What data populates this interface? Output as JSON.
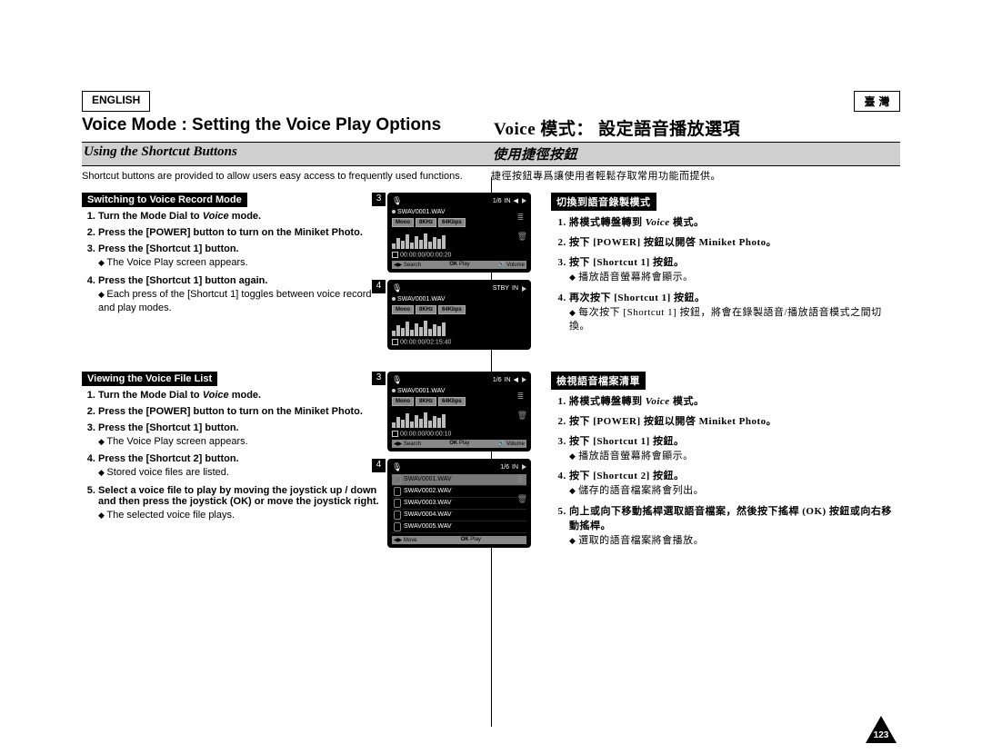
{
  "lang": {
    "en": "ENGLISH",
    "zh": "臺  灣"
  },
  "title": {
    "en": "Voice Mode : Setting the Voice Play Options",
    "zh": "Voice 模式： 設定語音播放選項"
  },
  "subtitle": {
    "en": "Using the Shortcut Buttons",
    "zh": "使用捷徑按鈕"
  },
  "intro": {
    "en": "Shortcut buttons are provided to allow users easy access to frequently used functions.",
    "zh": "捷徑按鈕專爲讓使用者輕鬆存取常用功能而提供。"
  },
  "sectionA": {
    "bar_en": "Switching to Voice Record Mode",
    "bar_zh": "切換到語音錄製模式",
    "en": {
      "s1a": "Turn the Mode Dial to ",
      "s1b": "Voice",
      "s1c": " mode.",
      "s2": "Press the [POWER] button to turn on the Miniket Photo.",
      "s3": "Press the [Shortcut 1] button.",
      "s3sub": "The Voice Play screen appears.",
      "s4": "Press the [Shortcut 1] button again.",
      "s4sub": "Each press of the [Shortcut 1] toggles between voice record and play modes."
    },
    "zh": {
      "s1a": "將模式轉盤轉到 ",
      "s1b": "Voice",
      "s1c": " 模式。",
      "s2": "按下 [POWER] 按鈕以開啓 Miniket Photo。",
      "s3": "按下 [Shortcut 1] 按鈕。",
      "s3sub": "播放語音螢幕將會顯示。",
      "s4": "再次按下 [Shortcut 1] 按鈕。",
      "s4sub": "每次按下 [Shortcut 1] 按鈕，將會在錄製語音/播放語音模式之間切換。"
    }
  },
  "sectionB": {
    "bar_en": "Viewing the Voice File List",
    "bar_zh": "檢視語音檔案清單",
    "en": {
      "s1a": "Turn the Mode Dial to ",
      "s1b": "Voice",
      "s1c": " mode.",
      "s2": "Press the [POWER] button to turn on the Miniket Photo.",
      "s3": "Press the [Shortcut 1] button.",
      "s3sub": "The Voice Play screen appears.",
      "s4": "Press the [Shortcut 2] button.",
      "s4sub": "Stored voice files are listed.",
      "s5": "Select a voice file to play by moving the joystick up / down and then press the joystick (OK) or move the joystick right.",
      "s5sub": "The selected voice file plays."
    },
    "zh": {
      "s1a": "將模式轉盤轉到 ",
      "s1b": "Voice",
      "s1c": " 模式。",
      "s2": "按下 [POWER] 按鈕以開啓 Miniket Photo。",
      "s3": "按下 [Shortcut 1] 按鈕。",
      "s3sub": "播放語音螢幕將會顯示。",
      "s4": "按下 [Shortcut 2] 按鈕。",
      "s4sub": "儲存的語音檔案將會列出。",
      "s5": "向上或向下移動搖桿選取語音檔案，然後按下搖桿 (OK) 按鈕或向右移動搖桿。",
      "s5sub": "選取的語音檔案將會播放。"
    }
  },
  "device": {
    "counter16": "1/6",
    "in": "IN",
    "file": "SWAV0001.WAV",
    "mono": "Mono",
    "khz": "8KHz",
    "kbps": "64Kbps",
    "time_a1": "00:00:00/00:00:20",
    "time_a2": "00:00:00/02:15:40",
    "time_b1": "00:00:00/00:00:10",
    "bottom_search": "Search",
    "bottom_ok": "OK",
    "bottom_play": "Play",
    "bottom_vol": "Volume",
    "bottom_move": "Move",
    "stby": "STBY",
    "files": [
      "SWAV0001.WAV",
      "SWAV0002.WAV",
      "SWAV0003.WAV",
      "SWAV0004.WAV",
      "SWAV0005.WAV"
    ],
    "badge3": "3",
    "badge4": "4"
  },
  "page_number": "123"
}
